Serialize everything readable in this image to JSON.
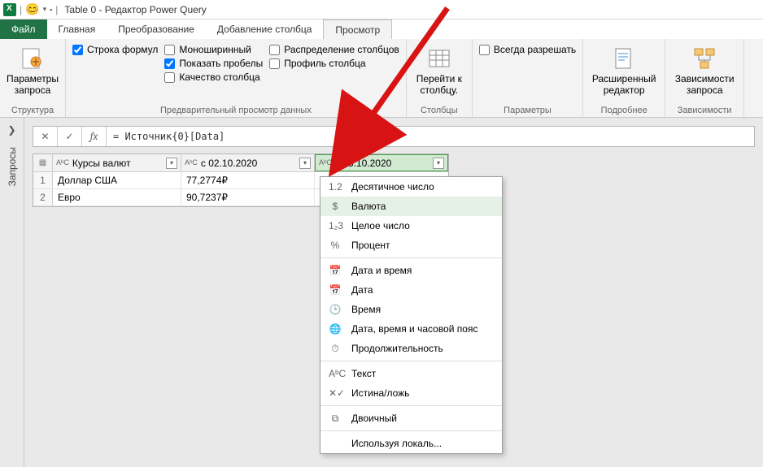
{
  "title": "Table 0 - Редактор Power Query",
  "tabs": {
    "file": "Файл",
    "home": "Главная",
    "transform": "Преобразование",
    "addcolumn": "Добавление столбца",
    "view": "Просмотр"
  },
  "ribbon": {
    "group_structure": "Структура",
    "group_preview": "Предварительный просмотр данных",
    "group_columns": "Столбцы",
    "group_params": "Параметры",
    "group_details": "Подробнее",
    "group_deps": "Зависимости",
    "btn_parameters": "Параметры запроса",
    "btn_goto_column": "Перейти к столбцу.",
    "btn_advanced": "Расширенный редактор",
    "btn_deps": "Зависимости запроса",
    "chk_formula_bar": "Строка формул",
    "chk_monospaced": "Моноширинный",
    "chk_show_spaces": "Показать пробелы",
    "chk_column_quality": "Качество столбца",
    "chk_column_dist": "Распределение столбцов",
    "chk_column_profile": "Профиль столбца",
    "chk_always_allow": "Всегда разрешать"
  },
  "side_panel": "Запросы",
  "formula": "= Источник{0}[Data]",
  "columns": {
    "col1": "Курсы валют",
    "col2": "с 02.10.2020",
    "col3": "с 03.10.2020"
  },
  "rows": [
    {
      "idx": "1",
      "name": "Доллар США",
      "v1": "77,2774₽"
    },
    {
      "idx": "2",
      "name": "Евро",
      "v1": "90,7237₽"
    }
  ],
  "type_menu": {
    "decimal": "Десятичное число",
    "currency": "Валюта",
    "integer": "Целое число",
    "percent": "Процент",
    "datetime": "Дата и время",
    "date": "Дата",
    "time": "Время",
    "dtz": "Дата, время и часовой пояс",
    "duration": "Продолжительность",
    "text": "Текст",
    "bool": "Истина/ложь",
    "binary": "Двоичный",
    "locale": "Используя локаль..."
  },
  "type_icons": {
    "decimal": "1.2",
    "currency": "$",
    "integer": "1₂3",
    "percent": "%",
    "datetime": "📅",
    "date": "📅",
    "time": "🕒",
    "dtz": "🌐",
    "duration": "⏱",
    "text": "AᵇC",
    "bool": "✕✓",
    "binary": "⧉",
    "locale": ""
  }
}
